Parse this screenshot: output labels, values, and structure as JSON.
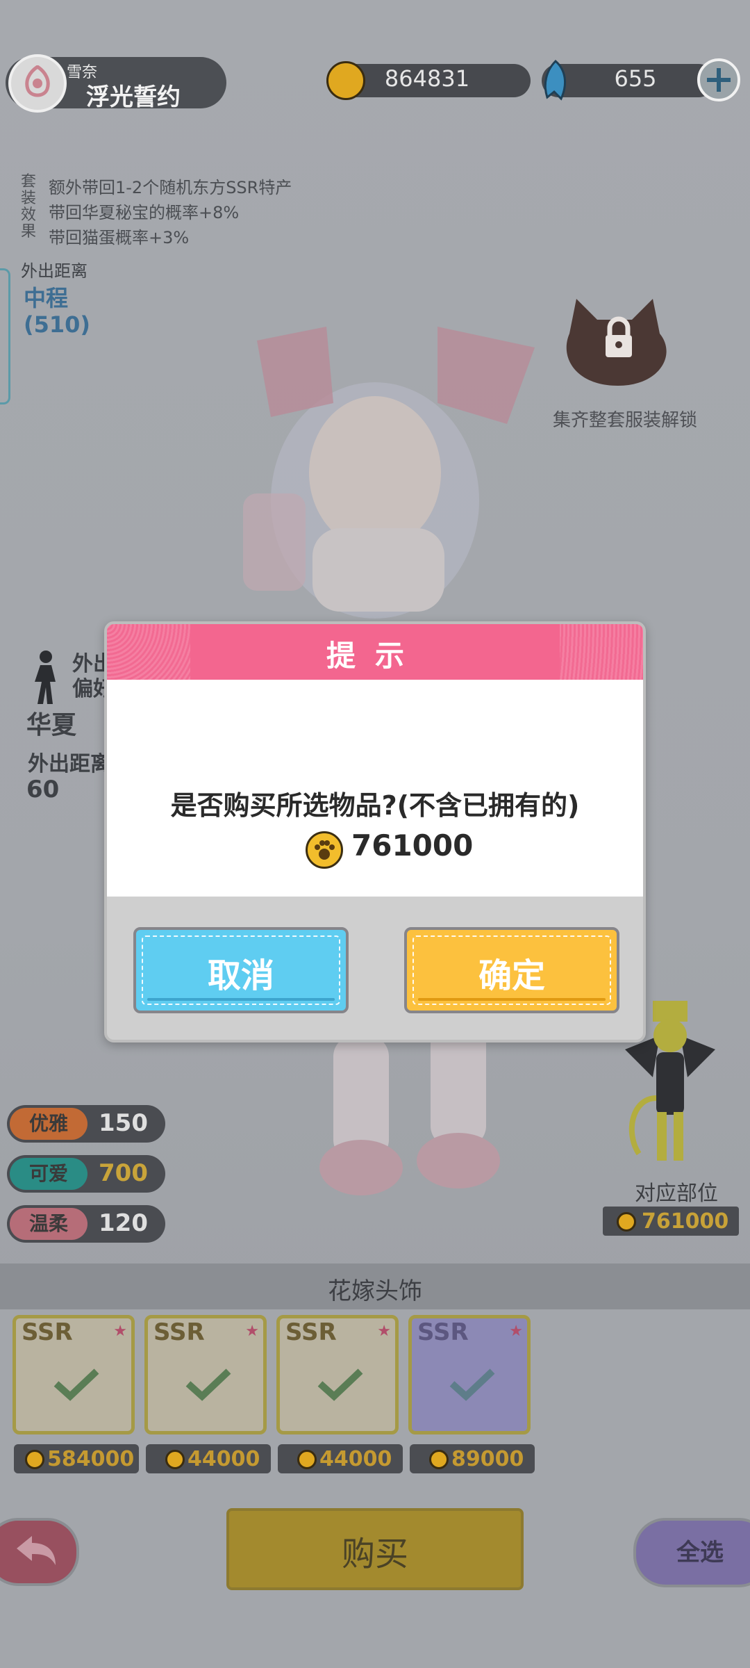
{
  "header": {
    "character_sub": "雪奈",
    "character_name": "浮光誓约",
    "currency_paw": "864831",
    "currency_gem": "655"
  },
  "set_effect": {
    "label": "套装效果",
    "lines": [
      "额外带回1-2个随机东方SSR特产",
      "带回华夏秘宝的概率+8%",
      "带回猫蛋概率+3%"
    ]
  },
  "outing": {
    "distance_label": "外出距离",
    "distance_type": "中程",
    "distance_value": "(510)",
    "preference_label": "外出\n偏好",
    "region": "华夏",
    "distance2_label": "外出距离",
    "distance2_value": "60"
  },
  "lock": {
    "text": "集齐整套服装解锁"
  },
  "attributes": [
    {
      "label": "优雅",
      "value": "150",
      "color": "#c26a35"
    },
    {
      "label": "可爱",
      "value": "700",
      "color": "#2a8c85"
    },
    {
      "label": "温柔",
      "value": "120",
      "color": "#b66d78"
    }
  ],
  "part": {
    "label": "对应部位",
    "price": "761000"
  },
  "category": {
    "title": "花嫁头饰"
  },
  "items": [
    {
      "rarity": "SSR",
      "price": "584000"
    },
    {
      "rarity": "SSR",
      "price": "44000"
    },
    {
      "rarity": "SSR",
      "price": "44000"
    },
    {
      "rarity": "SSR",
      "price": "89000"
    }
  ],
  "actions": {
    "buy": "购买",
    "select_all": "全选"
  },
  "dialog": {
    "title": "提示",
    "message": "是否购买所选物品?(不含已拥有的)",
    "amount": "761000",
    "cancel": "取消",
    "confirm": "确定"
  },
  "colors": {
    "dialog_header": "#f3668f",
    "cancel": "#5fcdf1",
    "confirm": "#fcc13e"
  }
}
